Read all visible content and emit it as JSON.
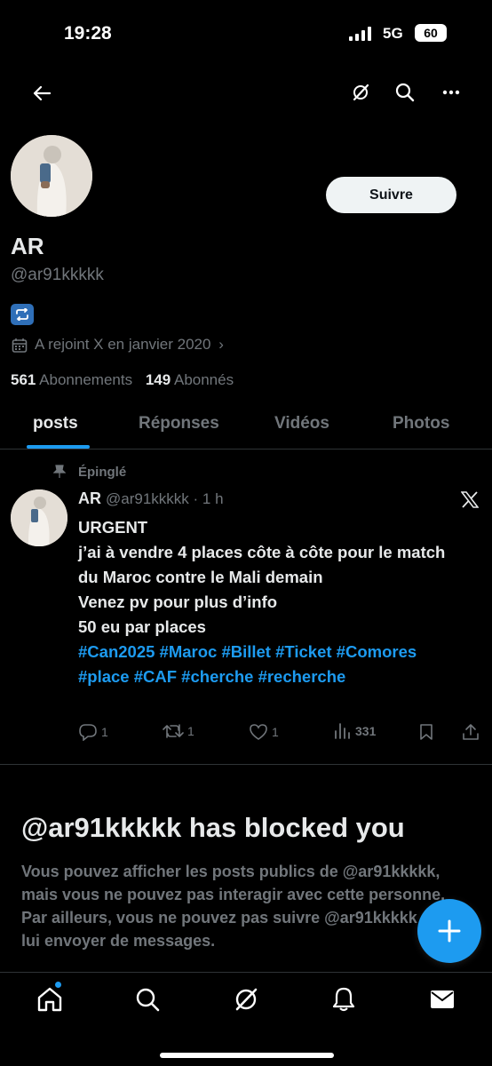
{
  "status_bar": {
    "time": "19:28",
    "network": "5G",
    "battery": "60"
  },
  "profile": {
    "follow_label": "Suivre",
    "name": "AR",
    "handle": "@ar91kkkkk",
    "joined": "A rejoint X en janvier 2020",
    "following_count": "561",
    "following_label": "Abonnements",
    "followers_count": "149",
    "followers_label": "Abonnés"
  },
  "tabs": [
    {
      "label": "posts",
      "active": true
    },
    {
      "label": "Réponses"
    },
    {
      "label": "Vidéos"
    },
    {
      "label": "Photos"
    }
  ],
  "post": {
    "pinned_label": "Épinglé",
    "author_name": "AR",
    "author_meta": "@ar91kkkkk · 1 h",
    "lines": [
      "URGENT",
      "j’ai à vendre 4 places côte à côte pour le match du Maroc contre le Mali demain",
      "Venez pv pour plus d’info",
      "50 eu par places"
    ],
    "hashtags": "#Can2025 #Maroc #Billet #Ticket #Comores #place #CAF #cherche #recherche",
    "replies": "1",
    "reposts": "1",
    "likes": "1",
    "views": "331"
  },
  "blocked": {
    "title": "@ar91kkkkk has blocked you",
    "text": "Vous pouvez afficher les posts publics de @ar91kkkkk, mais vous ne pouvez pas interagir avec cette personne. Par ailleurs, vous ne pouvez pas suivre @ar91kkkkk ni lui envoyer de messages."
  },
  "colors": {
    "accent": "#1d9bf0",
    "background": "#000000",
    "muted": "#71767b"
  },
  "icons": [
    "back-arrow-icon",
    "grok-icon",
    "search-icon",
    "more-icon",
    "repost-emoji-icon",
    "calendar-icon",
    "pin-icon",
    "x-logo-icon",
    "reply-icon",
    "repost-icon",
    "like-icon",
    "views-icon",
    "bookmark-icon",
    "share-icon",
    "plus-icon",
    "home-icon",
    "explore-icon",
    "notifications-icon",
    "messages-icon"
  ]
}
